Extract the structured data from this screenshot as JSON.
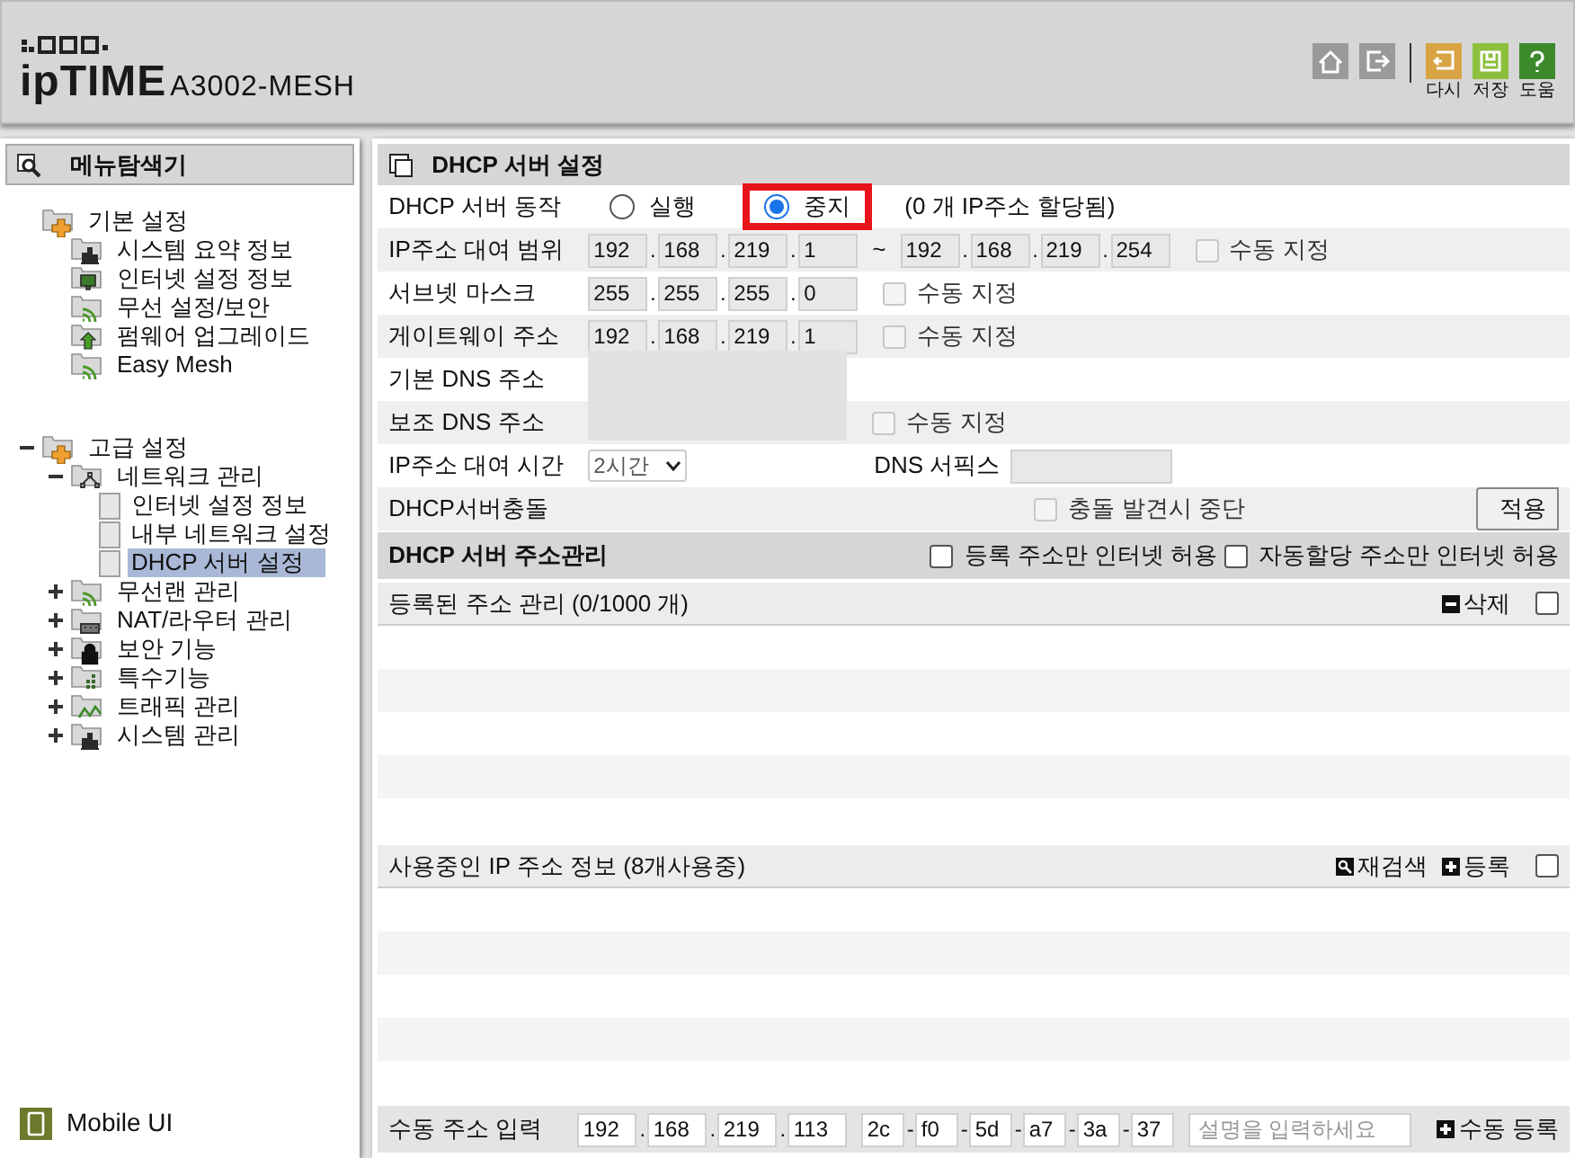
{
  "header": {
    "brand": "ipTIME",
    "model": "A3002-MESH",
    "tools": [
      {
        "kind": "home"
      },
      {
        "kind": "logout"
      },
      {
        "kind": "undo",
        "label": "다시"
      },
      {
        "kind": "save",
        "label": "저장"
      },
      {
        "kind": "help",
        "label": "도움"
      }
    ]
  },
  "sidebar": {
    "title": "메뉴탐색기",
    "tree": [
      {
        "label": "기본 설정",
        "kind": "folder",
        "children": [
          {
            "label": "시스템 요약 정보",
            "kind": "chart",
            "selected": false
          },
          {
            "label": "인터넷 설정 정보",
            "kind": "monitor",
            "selected": false
          },
          {
            "label": "무선 설정/보안",
            "kind": "wireless",
            "selected": false
          },
          {
            "label": "펌웨어 업그레이드",
            "kind": "upgrade",
            "selected": false
          },
          {
            "label": "Easy Mesh",
            "kind": "wireless",
            "selected": false
          }
        ]
      },
      {
        "label": "고급 설정",
        "kind": "folder",
        "expanded": true,
        "children": [
          {
            "label": "네트워크 관리",
            "kind": "network",
            "expanded": true,
            "children": [
              {
                "label": "인터넷 설정 정보",
                "kind": "page",
                "selected": false
              },
              {
                "label": "내부 네트워크 설정",
                "kind": "page",
                "selected": false
              },
              {
                "label": "DHCP 서버 설정",
                "kind": "page",
                "selected": true
              }
            ]
          },
          {
            "label": "무선랜 관리",
            "kind": "wireless",
            "expanded": false
          },
          {
            "label": "NAT/라우터 관리",
            "kind": "router",
            "expanded": false
          },
          {
            "label": "보안 기능",
            "kind": "lock",
            "expanded": false
          },
          {
            "label": "특수기능",
            "kind": "grid",
            "expanded": false
          },
          {
            "label": "트래픽 관리",
            "kind": "traffic",
            "expanded": false
          },
          {
            "label": "시스템 관리",
            "kind": "chart",
            "expanded": false
          }
        ]
      }
    ],
    "footer": "Mobile UI"
  },
  "main": {
    "title": "DHCP 서버 설정",
    "rows": [
      {
        "kind": "radio",
        "label": "DHCP 서버 동작",
        "options": [
          {
            "label": "실행",
            "selected": false,
            "highlighted": false
          },
          {
            "label": "중지",
            "selected": true,
            "highlighted": true
          }
        ],
        "note": "(0 개 IP주소 할당됨)"
      },
      {
        "kind": "range",
        "label": "IP주소 대여 범위",
        "start": [
          {
            "value": "192"
          },
          {
            "sep": ".",
            "value": "168"
          },
          {
            "sep": ".",
            "value": "219"
          },
          {
            "sep": ".",
            "value": "1"
          }
        ],
        "to": "~",
        "end": [
          {
            "value": "192"
          },
          {
            "sep": ".",
            "value": "168"
          },
          {
            "sep": ".",
            "value": "219"
          },
          {
            "sep": ".",
            "value": "254"
          }
        ],
        "check": {
          "label": "수동 지정",
          "checked": false
        }
      },
      {
        "kind": "ip",
        "label": "서브넷 마스크",
        "fields": [
          {
            "value": "255"
          },
          {
            "sep": ".",
            "value": "255"
          },
          {
            "sep": ".",
            "value": "255"
          },
          {
            "sep": ".",
            "value": "0"
          }
        ],
        "check": {
          "label": "수동 지정",
          "checked": false
        }
      },
      {
        "kind": "ip",
        "label": "게이트웨이 주소",
        "fields": [
          {
            "value": "192"
          },
          {
            "sep": ".",
            "value": "168"
          },
          {
            "sep": ".",
            "value": "219"
          },
          {
            "sep": ".",
            "value": "1"
          }
        ],
        "check": {
          "label": "수동 지정",
          "checked": false
        }
      },
      {
        "kind": "dns",
        "label": "기본 DNS 주소"
      },
      {
        "kind": "dns",
        "label": "보조 DNS 주소",
        "check": {
          "label": "수동 지정",
          "checked": false
        }
      },
      {
        "kind": "lease",
        "label": "IP주소 대여 시간",
        "select": "2시간",
        "suffix_label": "DNS 서픽스"
      },
      {
        "kind": "conflict",
        "label": "DHCP서버충돌",
        "check": {
          "label": "충돌 발견시 중단",
          "checked": false
        },
        "button": "적용"
      }
    ],
    "address": {
      "title": "DHCP 서버 주소관리",
      "checks": [
        {
          "label": "등록 주소만 인터넷 허용",
          "checked": false
        },
        {
          "label": "자동할당 주소만 인터넷 허용",
          "checked": false
        }
      ],
      "lists": [
        {
          "title": "등록된 주소 관리 (0/1000 개)",
          "actions": [
            {
              "kind": "minus",
              "label": "삭제"
            }
          ],
          "all_checked": false
        },
        {
          "title": "사용중인 IP 주소 정보 (8개사용중)",
          "actions": [
            {
              "kind": "search",
              "label": "재검색"
            },
            {
              "kind": "plus",
              "label": "등록"
            }
          ],
          "all_checked": false
        }
      ]
    },
    "manual": {
      "label": "수동 주소 입력",
      "ip": [
        {
          "value": "192"
        },
        {
          "sep": ".",
          "value": "168"
        },
        {
          "sep": ".",
          "value": "219"
        },
        {
          "sep": ".",
          "value": "113"
        }
      ],
      "mac": [
        {
          "value": "2c"
        },
        {
          "sep": "-",
          "value": "f0"
        },
        {
          "sep": "-",
          "value": "5d"
        },
        {
          "sep": "-",
          "value": "a7"
        },
        {
          "sep": "-",
          "value": "3a"
        },
        {
          "sep": "-",
          "value": "37"
        }
      ],
      "placeholder": "설명을 입력하세요",
      "button": "수동 등록"
    }
  }
}
